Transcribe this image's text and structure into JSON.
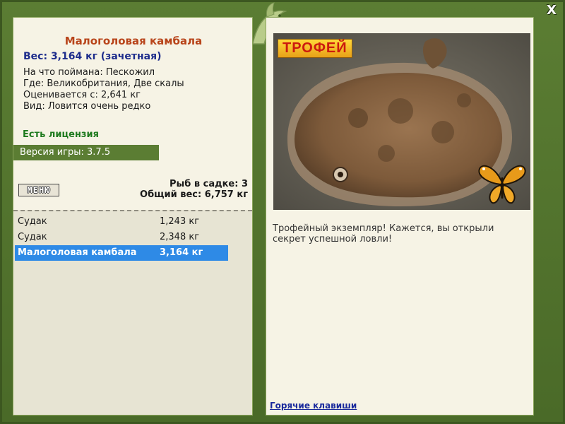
{
  "window": {
    "close_label": "X"
  },
  "fish": {
    "title": "Малоголовая камбала",
    "weight_line": "Вес: 3,164 кг (зачетная)",
    "info": [
      "На что поймана: Пескожил",
      "Где: Великобритания, Две скалы",
      "Оценивается с: 2,641 кг",
      "Вид: Ловится очень редко"
    ]
  },
  "license_label": "Есть лицензия",
  "version_label": "Версия игры: 3.7.5",
  "menu_label": "МЕНЮ",
  "net": {
    "count_line": "Рыб в садке: 3",
    "total_line": "Общий вес: 6,757 кг"
  },
  "catches": [
    {
      "name": "Судак",
      "weight": "1,243 кг",
      "selected": false
    },
    {
      "name": "Судак",
      "weight": "2,348 кг",
      "selected": false
    },
    {
      "name": "Малоголовая камбала",
      "weight": "3,164 кг",
      "selected": true
    }
  ],
  "trophy": {
    "badge": "ТРОФЕЙ",
    "text": "Трофейный экземпляр! Кажется, вы открыли секрет успешной ловли!"
  },
  "hotkeys_label": "Горячие клавиши",
  "colors": {
    "frame": "#4e6e2c",
    "panel": "#f6f3e5",
    "fish_title": "#b8441a",
    "weight": "#1e2d8c",
    "license": "#1e7a1e",
    "selection": "#2e8ae6"
  },
  "icons": [
    "dolphin-emblem-icon",
    "butterfly-icon",
    "close-icon"
  ]
}
